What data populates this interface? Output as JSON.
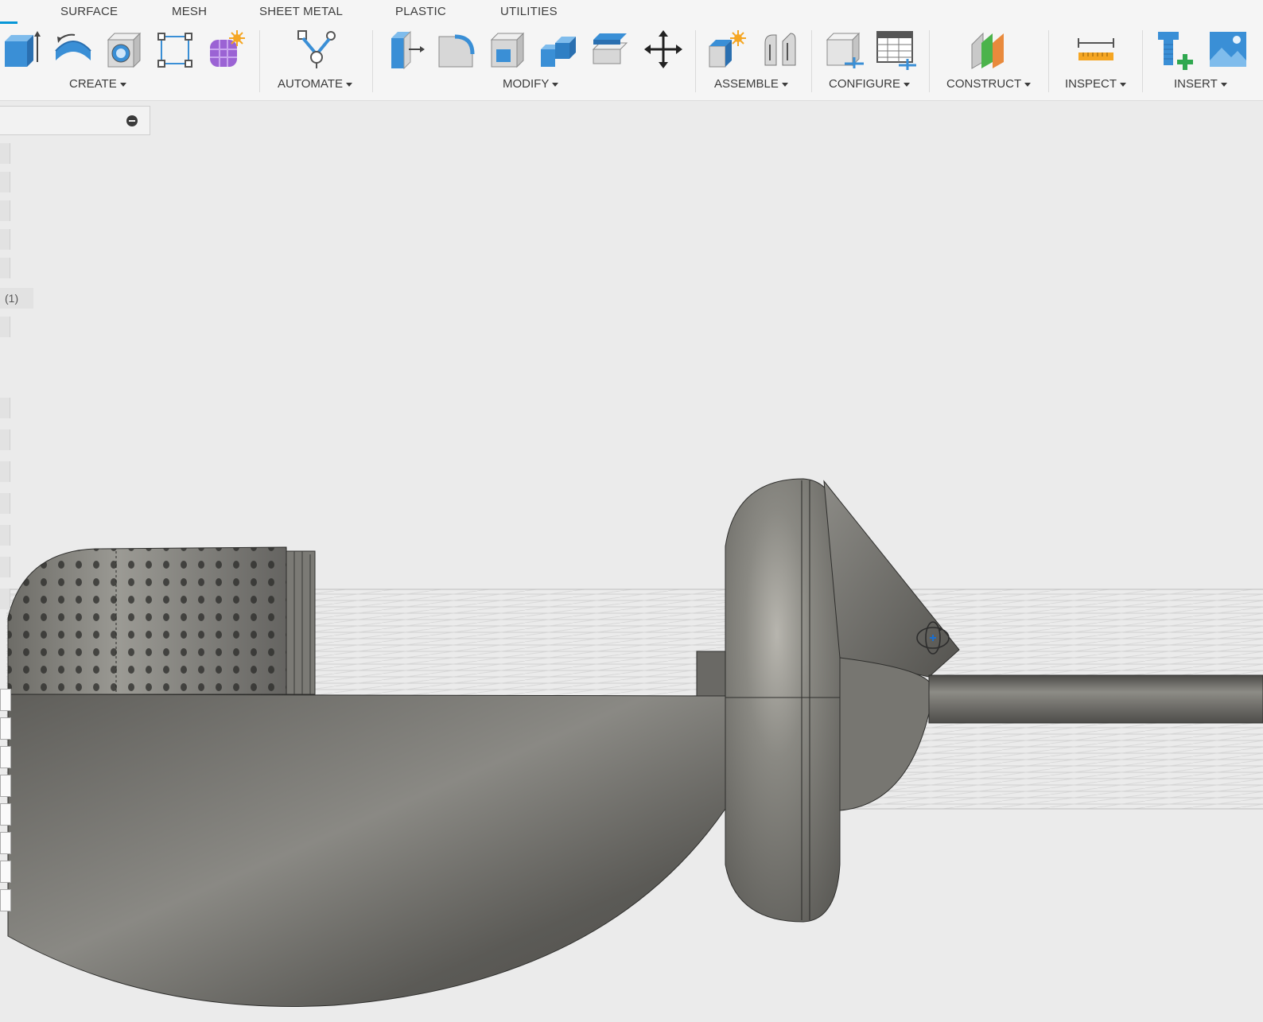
{
  "toolbar": {
    "active_tab_cut": "",
    "tabs": [
      "SURFACE",
      "MESH",
      "SHEET METAL",
      "PLASTIC",
      "UTILITIES"
    ],
    "groups": [
      "CREATE",
      "AUTOMATE",
      "MODIFY",
      "ASSEMBLE",
      "CONFIGURE",
      "CONSTRUCT",
      "INSPECT",
      "INSERT"
    ]
  },
  "tool_icons": [
    "extrude-icon",
    "revolve-icon",
    "hole-icon",
    "sketch-rectangle-icon",
    "form-icon",
    "automate-icon",
    "press-pull-icon",
    "fillet-icon",
    "shell-icon",
    "combine-icon",
    "offset-face-icon",
    "move-icon",
    "new-component-icon",
    "joint-icon",
    "configure-table-icon",
    "parameters-table-icon",
    "offset-plane-icon",
    "measure-icon",
    "insert-mcmaster-icon",
    "insert-canvas-icon"
  ],
  "browser": {
    "item_count_label": "(1)"
  },
  "colors": {
    "accent": "#0696d7",
    "tool_blue": "#3a8fd6",
    "model_gray": "#6a6964",
    "viewport_bg": "#ebebeb",
    "grid": "#c9c9c9"
  },
  "viewport": {
    "orbit_cursor": "orbit-cursor-icon"
  }
}
